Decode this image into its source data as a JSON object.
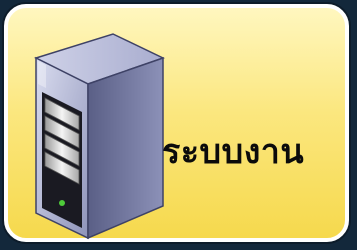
{
  "tile": {
    "label": "ระบบงาน",
    "icon": "server-tower-icon"
  },
  "colors": {
    "background": "#13283b",
    "tile_border": "#ffffff",
    "tile_fill": "#fbe77f",
    "label_text": "#0b0b0b"
  }
}
